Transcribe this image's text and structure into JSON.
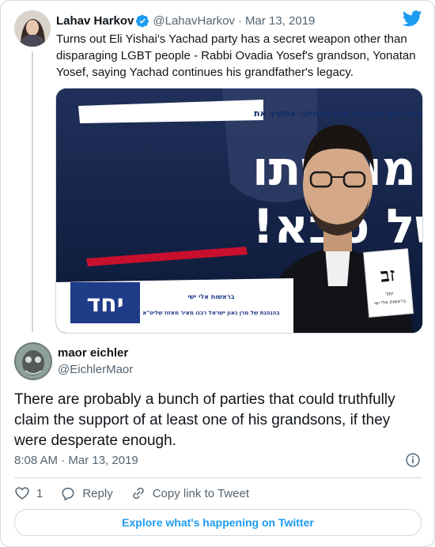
{
  "colors": {
    "accent": "#1d9bf0",
    "text": "#0f1419",
    "muted": "#536471",
    "border": "#cfd9de"
  },
  "parent_tweet": {
    "name": "Lahav Harkov",
    "handle": "@LahavHarkov",
    "separator": "·",
    "date": "Mar 13, 2019",
    "text": "Turns out Eli Yishai's Yachad party has a secret weapon other than disparaging LGBT people - Rabbi Ovadia Yosef's grandson, Yonatan Yosef, saying Yachad continues his grandfather's legacy.",
    "icons": {
      "verified": "verified-badge-icon",
      "brand": "twitter-bird-icon"
    },
    "poster": {
      "top_line": "יהונתן יוסף נכדו של מרן מתחייב: אמשיך את",
      "headline_1": "מורשתו",
      "headline_2": "של סבא!",
      "party": "יחד",
      "sub_1": "בראשות אלי ישי",
      "sub_2": "בהנהגת של מרן גאון ישראל רבנו מאיר מאזוז שליט\"א",
      "ballot_letters": "זב",
      "ballot_sub_1": "יחד",
      "ballot_sub_2": "בראשות אלי ישי"
    }
  },
  "tweet": {
    "name": "maor eichler",
    "handle": "@EichlerMaor",
    "text": "There are probably a bunch of parties that could truthfully claim the support of at least one of his grandsons, if they were desperate enough.",
    "timestamp": "8:08 AM · Mar 13, 2019",
    "actions": {
      "like_count": "1",
      "reply_label": "Reply",
      "copy_label": "Copy link to Tweet"
    },
    "explore_label": "Explore what's happening on Twitter"
  }
}
